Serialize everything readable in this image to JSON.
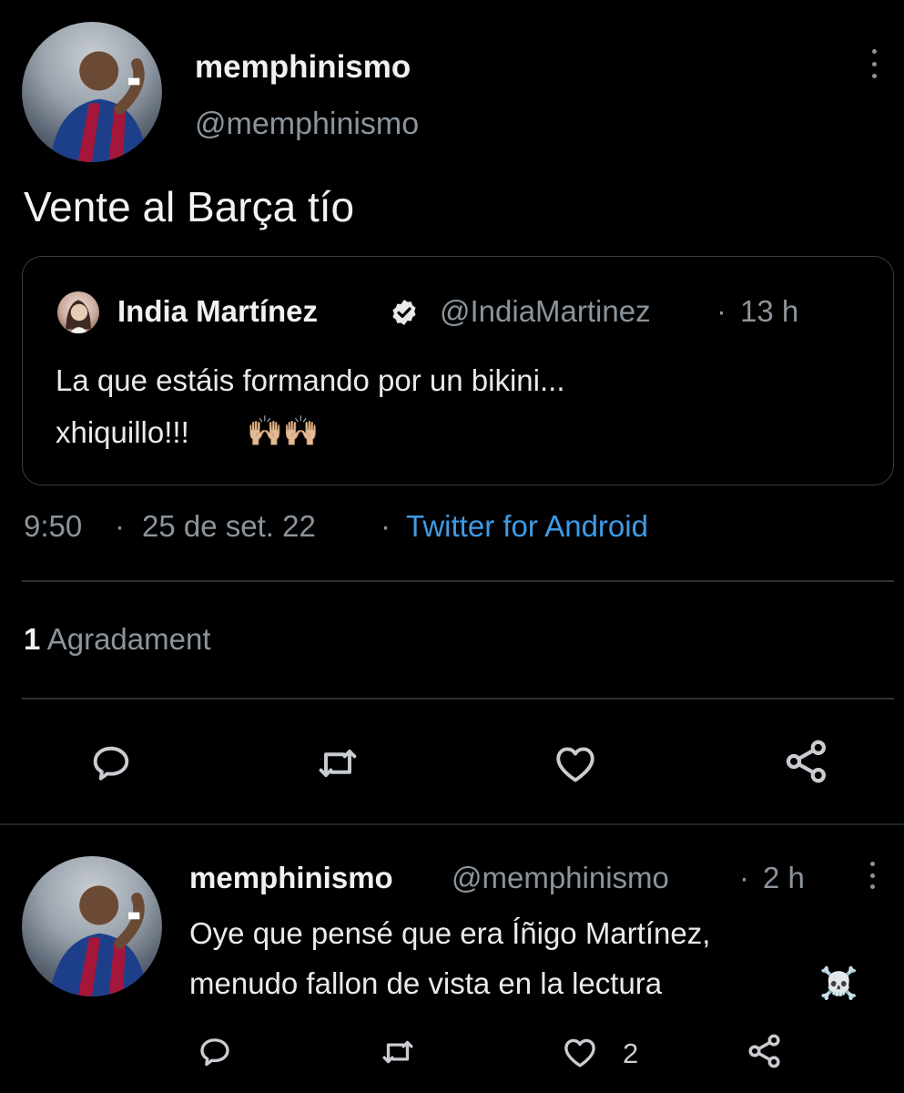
{
  "main_tweet": {
    "display_name": "memphinismo",
    "handle": "@memphinismo",
    "text": "Vente al Barça tío",
    "quoted": {
      "display_name": "India Martínez",
      "handle": "@IndiaMartinez",
      "separator": "·",
      "time": "13 h",
      "text_line1": "La que estáis formando por un bikini...",
      "text_line2": "xhiquillo!!!",
      "emoji": "🙌🏼🙌🏼"
    },
    "meta": {
      "time": "9:50",
      "separator": "·",
      "date": "25 de set. 22",
      "separator2": "·",
      "source": "Twitter for Android"
    },
    "likes_count": "1",
    "likes_label": "Agradament"
  },
  "reply": {
    "display_name": "memphinismo",
    "handle": "@memphinismo",
    "separator": "·",
    "time": "2 h",
    "text_line1": "Oye que pensé que era Íñigo Martínez,",
    "text_line2": "menudo fallon de vista en la lectura",
    "emoji": "☠️",
    "like_count": "2"
  },
  "icons": {
    "reply": "speech-bubble-icon",
    "retweet": "retweet-icon",
    "like": "heart-icon",
    "share": "share-icon",
    "more": "vertical-dots-icon",
    "verified": "verified-badge-icon"
  },
  "colors": {
    "background": "#000000",
    "text": "#e7e9ea",
    "muted": "#8b949c",
    "link": "#3e9be6"
  }
}
